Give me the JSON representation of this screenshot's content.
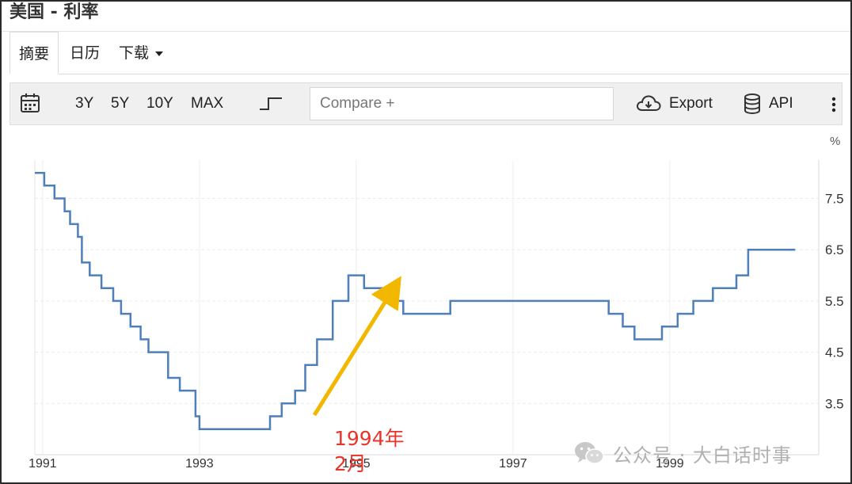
{
  "window": {
    "title": "美国 - 利率"
  },
  "tabs": [
    {
      "label": "摘要",
      "active": true
    },
    {
      "label": "日历",
      "active": false
    },
    {
      "label": "下载",
      "active": false,
      "dropdown": true
    }
  ],
  "toolbar": {
    "calendar_icon": "calendar-icon",
    "ranges": [
      "3Y",
      "5Y",
      "10Y",
      "MAX"
    ],
    "step_icon": "step-line-icon",
    "compare_placeholder": "Compare +",
    "export_label": "Export",
    "export_icon": "cloud-download-icon",
    "api_label": "API",
    "api_icon": "database-icon",
    "more_icon": "vertical-dots-icon"
  },
  "chart_data": {
    "type": "line",
    "step": true,
    "ylabel": "%",
    "ylim": [
      2.5,
      8.25
    ],
    "yticks": [
      3.5,
      4.5,
      5.5,
      6.5,
      7.5
    ],
    "ytick_labels": [
      "3.5",
      "4.5",
      "5.5",
      "6.5",
      "7.5"
    ],
    "xlim": [
      1990.9,
      2000.9
    ],
    "xticks": [
      1991,
      1993,
      1995,
      1997,
      1999
    ],
    "xtick_labels": [
      "1991",
      "1993",
      "1995",
      "1997",
      "1999"
    ],
    "series_color": "#4e7fba",
    "grid": true,
    "series": [
      {
        "name": "",
        "x": [
          1990.9,
          1991.02,
          1991.15,
          1991.28,
          1991.35,
          1991.45,
          1991.5,
          1991.6,
          1991.75,
          1991.9,
          1992.0,
          1992.12,
          1992.25,
          1992.35,
          1992.6,
          1992.75,
          1992.95,
          1993.0,
          1993.9,
          1994.05,
          1994.22,
          1994.35,
          1994.5,
          1994.7,
          1994.9,
          1995.1,
          1995.4,
          1995.6,
          1996.0,
          1996.2,
          1997.1,
          1998.0,
          1998.22,
          1998.4,
          1998.55,
          1998.9,
          1999.1,
          1999.3,
          1999.55,
          1999.85,
          2000.0,
          2000.15,
          2000.35,
          2000.6
        ],
        "y": [
          8.0,
          7.75,
          7.5,
          7.25,
          7.0,
          6.75,
          6.25,
          6.0,
          5.75,
          5.5,
          5.25,
          5.0,
          4.75,
          4.5,
          4.0,
          3.75,
          3.25,
          3.0,
          3.25,
          3.5,
          3.75,
          4.25,
          4.75,
          5.5,
          6.0,
          5.75,
          5.5,
          5.25,
          5.25,
          5.5,
          5.5,
          5.5,
          5.25,
          5.0,
          4.75,
          5.0,
          5.25,
          5.5,
          5.75,
          6.0,
          6.5,
          6.5,
          6.5,
          6.5
        ]
      }
    ],
    "annotations": [
      {
        "text": "1994年",
        "color": "#e8352a"
      },
      {
        "text": "2月",
        "color": "#e8352a"
      }
    ],
    "arrow_color": "#f2b800"
  },
  "watermark": {
    "text": "公众号 · 大白话时事",
    "icon": "wechat-icon"
  }
}
